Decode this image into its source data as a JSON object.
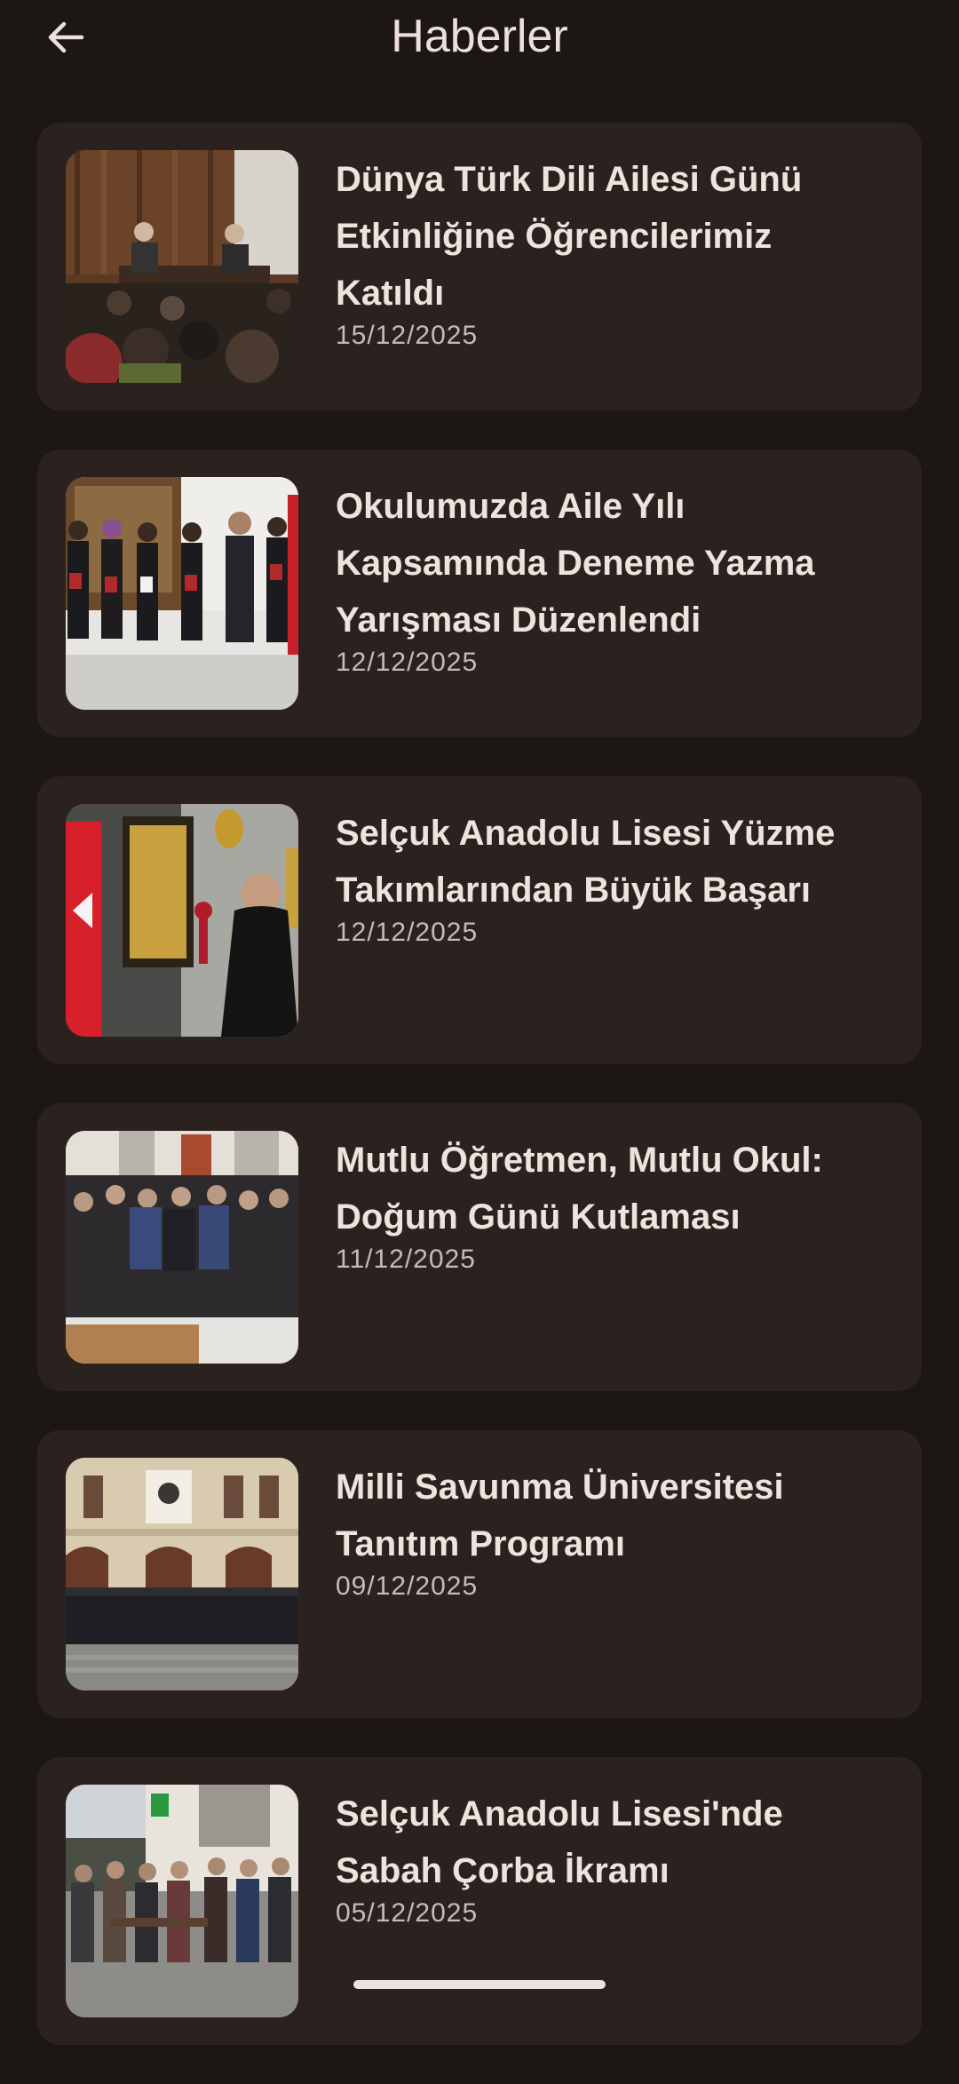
{
  "header": {
    "title": "Haberler",
    "back_icon": "arrow-left-icon"
  },
  "news": [
    {
      "title": "Dünya Türk Dili Ailesi Günü Etkinliğine Öğrencilerimiz Katıldı",
      "date": "15/12/2025"
    },
    {
      "title": "Okulumuzda Aile Yılı Kapsamında Deneme Yazma Yarışması Düzenlendi",
      "date": "12/12/2025"
    },
    {
      "title": "Selçuk Anadolu Lisesi Yüzme Takımlarından Büyük Başarı",
      "date": "12/12/2025"
    },
    {
      "title": "Mutlu Öğretmen, Mutlu Okul: Doğum Günü Kutlaması",
      "date": "11/12/2025"
    },
    {
      "title": "Milli Savunma Üniversitesi Tanıtım Programı",
      "date": "09/12/2025"
    },
    {
      "title": "Selçuk Anadolu Lisesi'nde Sabah Çorba İkramı",
      "date": "05/12/2025"
    }
  ],
  "colors": {
    "background": "#1c1614",
    "card": "#2b2220",
    "title_text": "#efe3de",
    "date_text": "#c8bab5"
  }
}
